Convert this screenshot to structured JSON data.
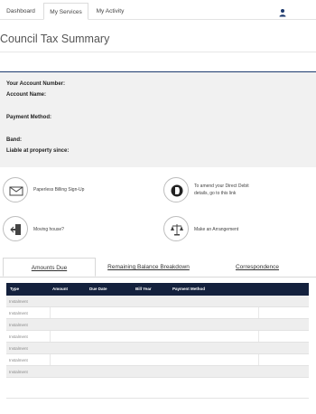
{
  "nav": {
    "tabs": [
      {
        "label": "Dashboard"
      },
      {
        "label": "My Services"
      },
      {
        "label": "My Activity"
      }
    ],
    "active_tab": "My Services",
    "user_icon": "user-icon"
  },
  "page": {
    "title": "Council Tax Summary"
  },
  "account": {
    "labels": {
      "account_number": "Your Account Number:",
      "account_name": "Account Name:",
      "payment_method": "Payment Method:",
      "band": "Band:",
      "liable_since": "Liable at property since:"
    }
  },
  "services": [
    {
      "label": "Paperless Billing Sign-Up",
      "icon": "envelope-icon"
    },
    {
      "label_line1": "To amend your Direct Debit",
      "label_line2": "details, go to this link",
      "icon": "direct-debit-icon"
    },
    {
      "label": "Moving house?",
      "icon": "moving-house-icon"
    },
    {
      "label": "Make an Arrangement",
      "icon": "scales-icon"
    }
  ],
  "tabs": {
    "items": [
      {
        "label": "Amounts Due"
      },
      {
        "label": "Remaining Balance Breakdown"
      },
      {
        "label": "Correspondence"
      }
    ],
    "active": "Amounts Due"
  },
  "table": {
    "columns": [
      "Type",
      "Amount",
      "Due Date",
      "Bill Year",
      "Payment Method"
    ],
    "rows": [
      {
        "type": "Instalment"
      },
      {
        "type": "Instalment"
      },
      {
        "type": "Instalment"
      },
      {
        "type": "Instalment"
      },
      {
        "type": "Instalment"
      },
      {
        "type": "Instalment"
      },
      {
        "type": "Instalment"
      }
    ]
  },
  "colors": {
    "header_navy": "#14213d",
    "accent_line": "#1d3a6e"
  }
}
